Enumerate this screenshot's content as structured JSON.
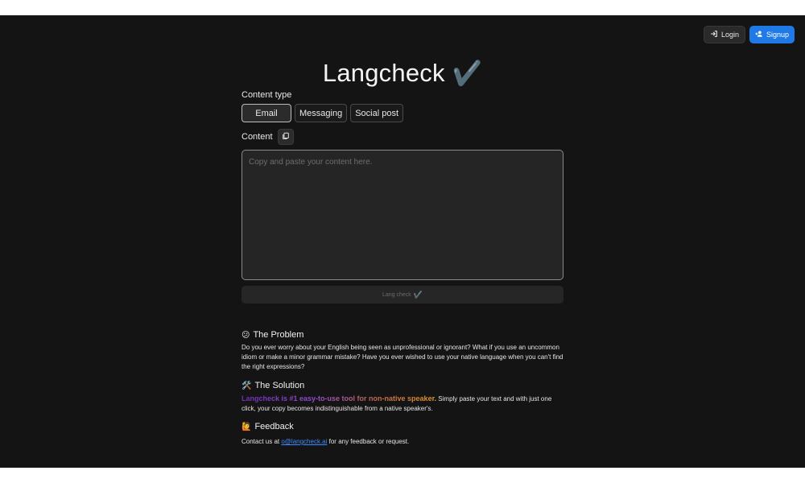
{
  "header": {
    "login_label": "Login",
    "signup_label": "Signup",
    "accent_color": "#1f7ae8"
  },
  "main": {
    "title": "Langcheck",
    "title_emoji": "✔️",
    "content_type_label": "Content type",
    "content_types": [
      {
        "label": "Email",
        "selected": true
      },
      {
        "label": "Messaging",
        "selected": false
      },
      {
        "label": "Social post",
        "selected": false
      }
    ],
    "content_label": "Content",
    "content_placeholder": "Copy and paste your content here.",
    "submit_label": "Lang check",
    "submit_emoji": "✔️"
  },
  "sections": {
    "problem": {
      "emoji": "😕",
      "heading": "The Problem",
      "body": "Do you ever worry about your English being seen as unprofessional or ignorant? What if you use an uncommon idiom or make a minor grammar mistake? Have you ever wished to use your native language when you can't find the right expressions?"
    },
    "solution": {
      "emoji": "🛠️",
      "heading": "The Solution",
      "highlight": "Langcheck is #1 easy-to-use tool for non-native speaker.",
      "body": " Simply paste your text and with just one click, your copy becomes indistinguishable from a native speaker's."
    },
    "feedback": {
      "emoji": "🙋",
      "heading": "Feedback",
      "body_prefix": "Contact us at ",
      "email": "o@langcheck.ai",
      "body_suffix": " for any feedback or request."
    }
  },
  "icons": {
    "login": "login-icon",
    "signup": "add-user-icon",
    "copy": "copy-icon"
  }
}
